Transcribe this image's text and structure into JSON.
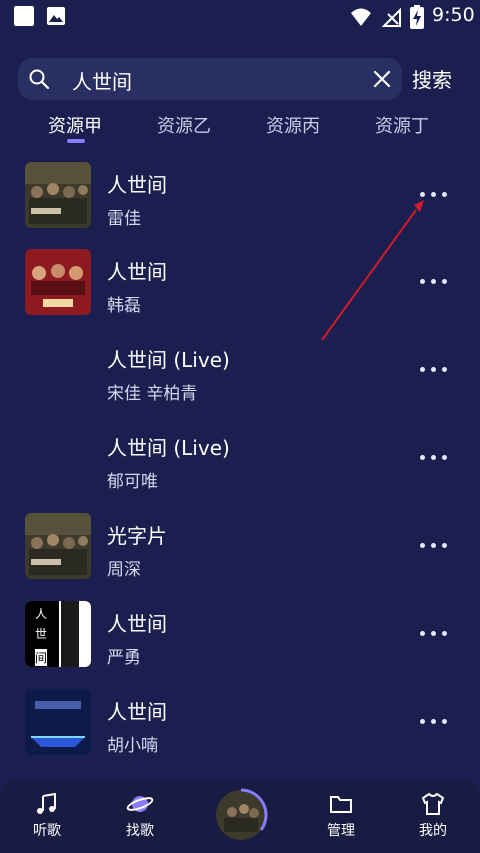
{
  "status_bar": {
    "time": "9:50",
    "icons": [
      "app-square-icon",
      "image-icon",
      "wifi-icon",
      "no-signal-icon",
      "battery-charging-icon"
    ]
  },
  "search": {
    "query": "人世间",
    "clear_icon": "close-icon",
    "search_label": "搜索"
  },
  "tabs": [
    {
      "label": "资源甲",
      "active": true
    },
    {
      "label": "资源乙",
      "active": false
    },
    {
      "label": "资源丙",
      "active": false
    },
    {
      "label": "资源丁",
      "active": false
    }
  ],
  "songs": [
    {
      "title": "人世间",
      "artist": "雷佳",
      "cover": "drama-poster"
    },
    {
      "title": "人世间",
      "artist": "韩磊",
      "cover": "red-poster"
    },
    {
      "title": "人世间 (Live)",
      "artist": "宋佳  辛柏青",
      "cover": "none"
    },
    {
      "title": "人世间 (Live)",
      "artist": "郁可唯",
      "cover": "none"
    },
    {
      "title": "光字片",
      "artist": "周深",
      "cover": "drama-poster"
    },
    {
      "title": "人世间",
      "artist": "严勇",
      "cover": "bw-poster"
    },
    {
      "title": "人世间",
      "artist": "胡小喃",
      "cover": "blue-stage"
    }
  ],
  "bw_cover_text": [
    "人",
    "世",
    "间"
  ],
  "bottom_nav": [
    {
      "label": "听歌",
      "icon": "music-note-icon"
    },
    {
      "label": "找歌",
      "icon": "planet-icon"
    },
    {
      "label": "管理",
      "icon": "folder-icon"
    },
    {
      "label": "我的",
      "icon": "tshirt-icon"
    }
  ],
  "colors": {
    "background": "#1b1f4f",
    "accent": "#8a7cff",
    "arrow": "#d21a2a"
  }
}
